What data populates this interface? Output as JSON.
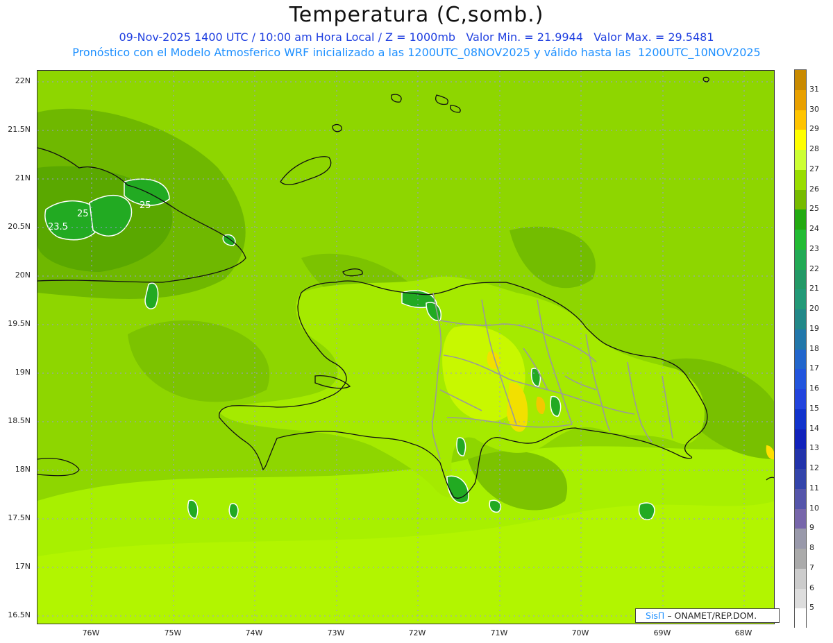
{
  "title": "Temperatura (C,somb.)",
  "subtitle_line1": "09-Nov-2025 1400 UTC / 10:00 am Hora Local / Z = 1000mb   Valor Min. = 21.9944   Valor Max. = 29.5481",
  "subtitle_line2": "Pronóstico con el Modelo Atmosferico WRF inicializado a las 1200UTC_08NOV2025 y válido hasta las  1200UTC_10NOV2025",
  "y_axis_labels": [
    "22N",
    "21.5N",
    "21N",
    "20.5N",
    "20N",
    "19.5N",
    "19N",
    "18.5N",
    "18N",
    "17.5N",
    "17N",
    "16.5N"
  ],
  "x_axis_labels": [
    "76W",
    "75W",
    "74W",
    "73W",
    "72W",
    "71W",
    "70W",
    "69W",
    "68W"
  ],
  "colorbar": {
    "labels": [
      "31",
      "30",
      "29",
      "28",
      "27",
      "26",
      "25",
      "24",
      "23",
      "22",
      "21",
      "20",
      "19",
      "18",
      "17",
      "16",
      "15",
      "14",
      "13",
      "12",
      "11",
      "10",
      "9",
      "8",
      "7",
      "6",
      "5"
    ],
    "colors": [
      "#c98a00",
      "#e8a000",
      "#ffc400",
      "#ffff00",
      "#ccff33",
      "#99dd00",
      "#77bb00",
      "#22aa11",
      "#22bb33",
      "#22aa55",
      "#229966",
      "#229977",
      "#228888",
      "#2277aa",
      "#2266cc",
      "#2255dd",
      "#2244dd",
      "#1133cc",
      "#1122bb",
      "#2233aa",
      "#3344aa",
      "#5555aa",
      "#7766aa",
      "#9999aa",
      "#aaaaaa",
      "#cccccc",
      "#dddddd",
      "#ffffff"
    ]
  },
  "contour_labels": [
    "23.5",
    "25",
    "25"
  ],
  "credit": {
    "prefix": "SisΠ",
    "text": "– ONAMET/REP.DOM."
  }
}
